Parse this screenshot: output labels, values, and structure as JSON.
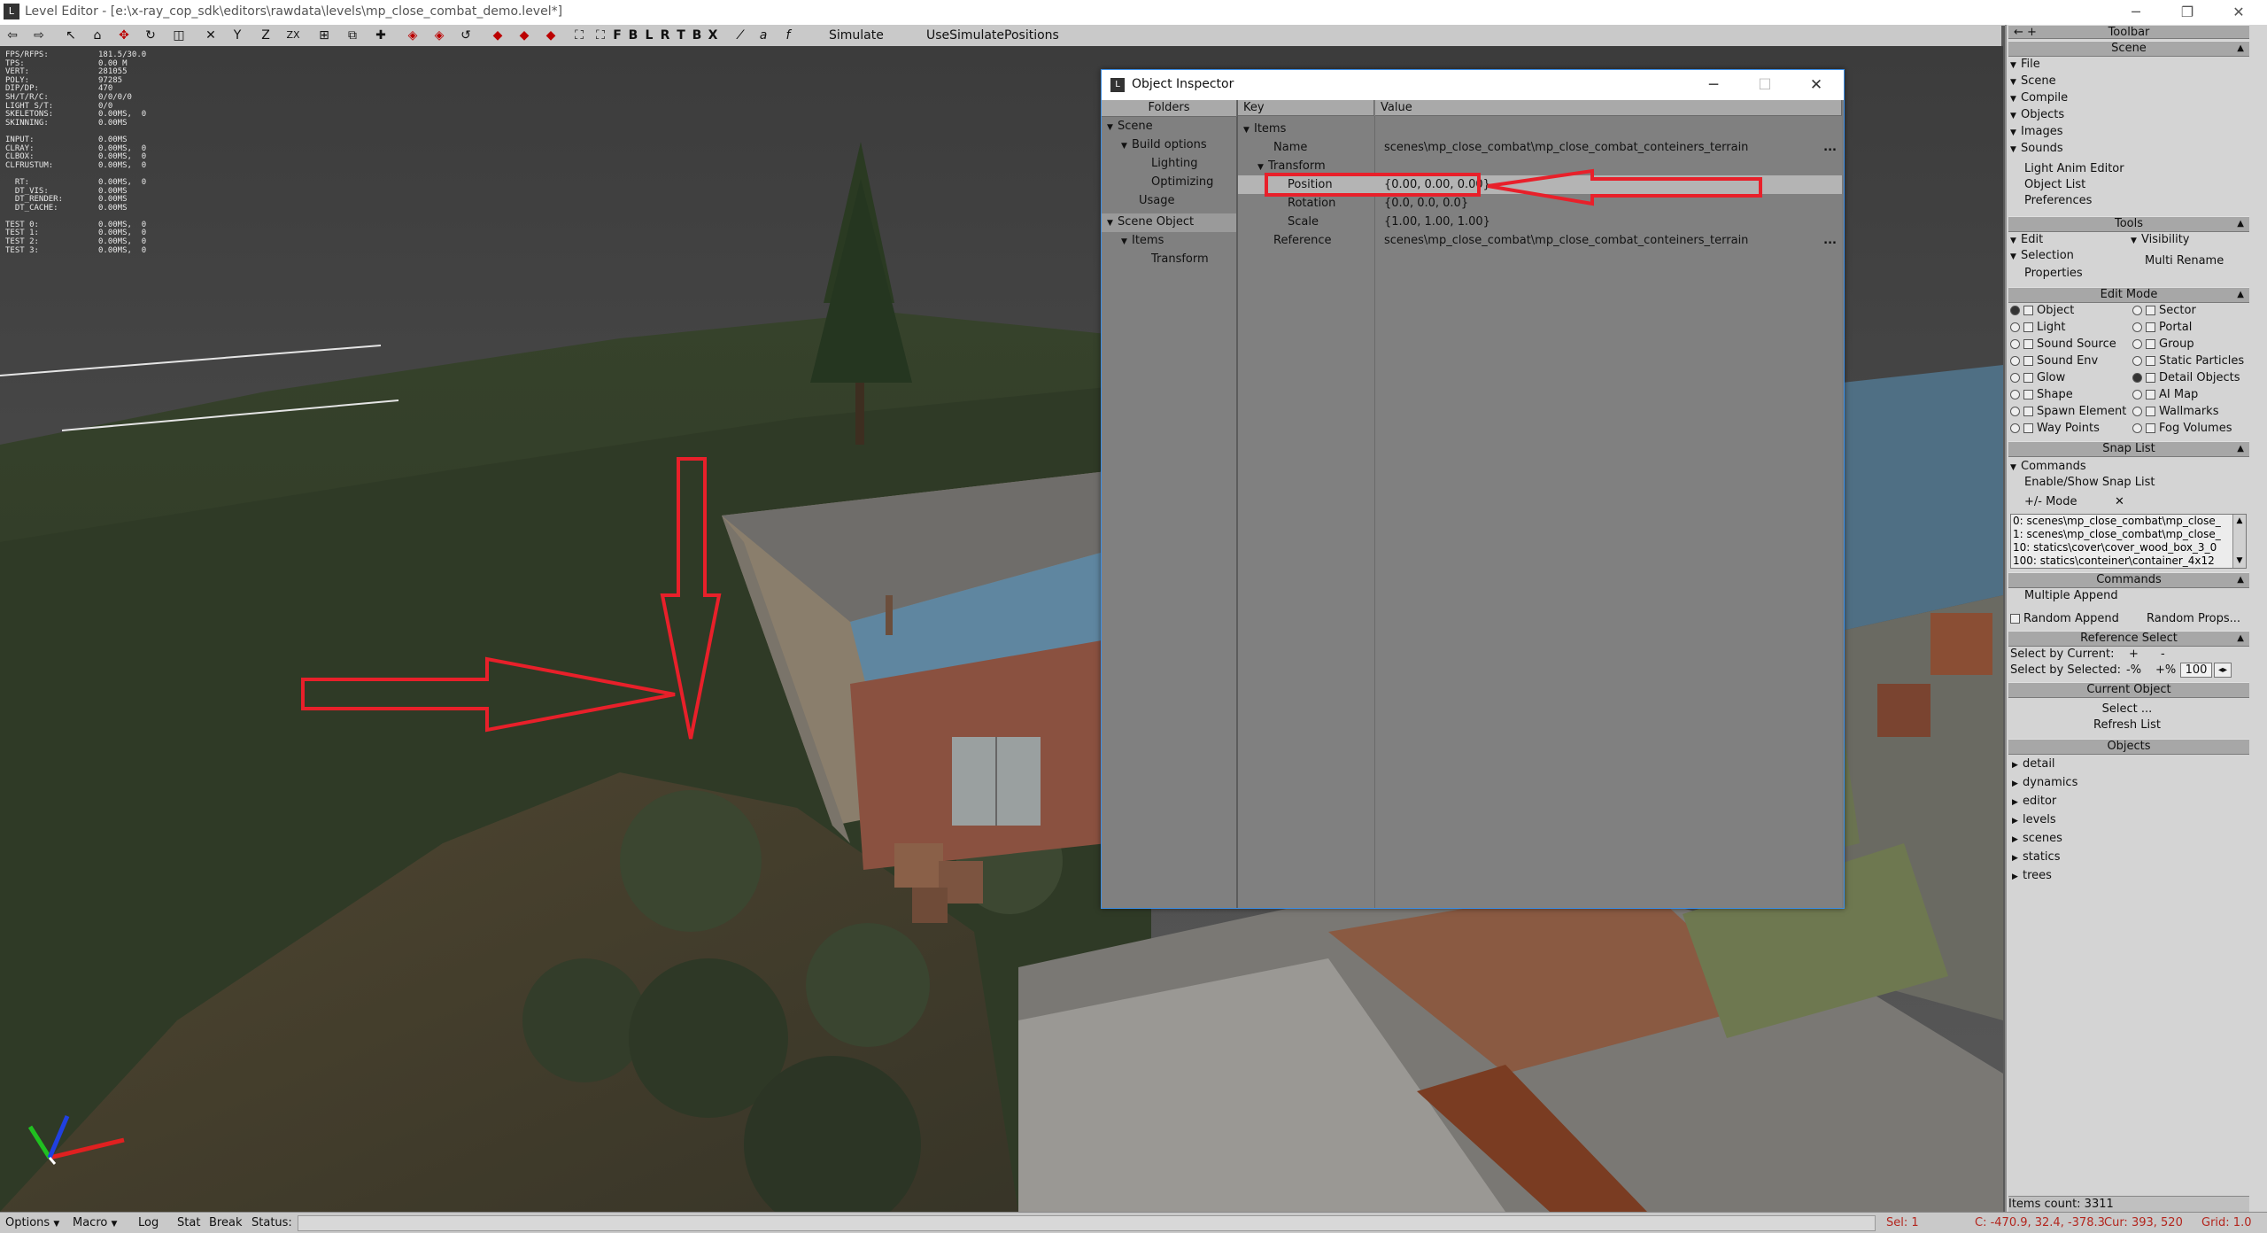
{
  "window": {
    "title": "Level Editor - [e:\\x-ray_cop_sdk\\editors\\rawdata\\levels\\mp_close_combat_demo.level*]",
    "app_icon": "L",
    "minimize": "─",
    "restore": "❐",
    "close": "✕"
  },
  "toolbar": {
    "axis_labels": [
      "Y",
      "Z",
      "ZX"
    ],
    "view_labels": [
      "F",
      "B",
      "L",
      "R",
      "T",
      "B",
      "X"
    ],
    "simulate": "Simulate",
    "use_simulate_positions": "UseSimulatePositions"
  },
  "stats": [
    {
      "k": "FPS/RFPS:",
      "v": "181.5/30.0"
    },
    {
      "k": "TPS:",
      "v": "0.00 M"
    },
    {
      "k": "VERT:",
      "v": "281055"
    },
    {
      "k": "POLY:",
      "v": "97285"
    },
    {
      "k": "DIP/DP:",
      "v": "470"
    },
    {
      "k": "SH/T/R/C:",
      "v": "0/0/0/0"
    },
    {
      "k": "LIGHT S/T:",
      "v": "0/0"
    },
    {
      "k": "SKELETONS:",
      "v": "0.00MS,  0"
    },
    {
      "k": "SKINNING:",
      "v": "0.00MS"
    },
    {
      "k": "",
      "v": ""
    },
    {
      "k": "INPUT:",
      "v": "0.00MS"
    },
    {
      "k": "CLRAY:",
      "v": "0.00MS,  0"
    },
    {
      "k": "CLBOX:",
      "v": "0.00MS,  0"
    },
    {
      "k": "CLFRUSTUM:",
      "v": "0.00MS,  0"
    },
    {
      "k": "",
      "v": ""
    },
    {
      "k": "  RT:",
      "v": "0.00MS,  0"
    },
    {
      "k": "  DT_VIS:",
      "v": "0.00MS"
    },
    {
      "k": "  DT_RENDER:",
      "v": "0.00MS"
    },
    {
      "k": "  DT_CACHE:",
      "v": "0.00MS"
    },
    {
      "k": "",
      "v": ""
    },
    {
      "k": "TEST 0:",
      "v": "0.00MS,  0"
    },
    {
      "k": "TEST 1:",
      "v": "0.00MS,  0"
    },
    {
      "k": "TEST 2:",
      "v": "0.00MS,  0"
    },
    {
      "k": "TEST 3:",
      "v": "0.00MS,  0"
    }
  ],
  "inspector": {
    "title": "Object Inspector",
    "folders_header": "Folders",
    "key_header": "Key",
    "value_header": "Value",
    "folders": {
      "scene": "Scene",
      "build_options": "Build options",
      "lighting": "Lighting",
      "optimizing": "Optimizing",
      "usage": "Usage",
      "scene_object": "Scene Object",
      "items": "Items",
      "transform": "Transform"
    },
    "props": {
      "items": "Items",
      "name_key": "Name",
      "name_val": "scenes\\mp_close_combat\\mp_close_combat_conteiners_terrain",
      "transform": "Transform",
      "position_key": "Position",
      "position_val": "{0.00, 0.00, 0.00}",
      "rotation_key": "Rotation",
      "rotation_val": "{0.0, 0.0, 0.0}",
      "scale_key": "Scale",
      "scale_val": "{1.00, 1.00, 1.00}",
      "reference_key": "Reference",
      "reference_val": "scenes\\mp_close_combat\\mp_close_combat_conteiners_terrain",
      "dots": "..."
    }
  },
  "right_panel": {
    "toolbar_header": "Toolbar",
    "scene_header": "Scene",
    "scene_items": [
      "File",
      "Scene",
      "Compile",
      "Objects",
      "Images",
      "Sounds"
    ],
    "scene_plain": [
      "Light Anim Editor",
      "Object List",
      "Preferences"
    ],
    "tools_header": "Tools",
    "edit": "Edit",
    "visibility": "Visibility",
    "selection": "Selection",
    "multi_rename": "Multi Rename",
    "properties": "Properties",
    "edit_mode_header": "Edit Mode",
    "modes_left": [
      "Object",
      "Light",
      "Sound Source",
      "Sound Env",
      "Glow",
      "Shape",
      "Spawn Element",
      "Way Points"
    ],
    "modes_right": [
      "Sector",
      "Portal",
      "Group",
      "Static Particles",
      "Detail Objects",
      "AI Map",
      "Wallmarks",
      "Fog Volumes"
    ],
    "snap_list_header": "Snap List",
    "commands": "Commands",
    "enable_show_snap": "Enable/Show Snap List",
    "mode": "+/- Mode",
    "mode_x": "✕",
    "snap_items": [
      "0: scenes\\mp_close_combat\\mp_close_",
      "1: scenes\\mp_close_combat\\mp_close_",
      "10: statics\\cover\\cover_wood_box_3_0",
      "100: statics\\conteiner\\container_4x12"
    ],
    "commands_header": "Commands",
    "multiple_append": "Multiple Append",
    "random_append": "Random Append",
    "random_props": "Random Props...",
    "reference_select_header": "Reference Select",
    "select_by_current": "Select by Current:",
    "plus": "+",
    "minus": "-",
    "select_by_selected": "Select by Selected:",
    "pct_minus": "-%",
    "pct_plus": "+%",
    "pct_value": "100",
    "current_object_header": "Current Object",
    "select_btn": "Select ...",
    "refresh_list": "Refresh List",
    "objects_header": "Objects",
    "object_folders": [
      "detail",
      "dynamics",
      "editor",
      "levels",
      "scenes",
      "statics",
      "trees"
    ],
    "items_count": "Items count: 3311"
  },
  "statusbar": {
    "options": "Options",
    "macro": "Macro",
    "log": "Log",
    "stat": "Stat",
    "break": "Break",
    "status": "Status:",
    "sel": "Sel: 1",
    "coords": "C: -470.9, 32.4, -378.3",
    "cur": "Cur: 393, 520",
    "grid": "Grid: 1.0"
  },
  "colors": {
    "annotation_red": "#e8202a",
    "axis_x": "#e02020",
    "axis_y": "#20c020",
    "axis_z": "#2040e0"
  }
}
